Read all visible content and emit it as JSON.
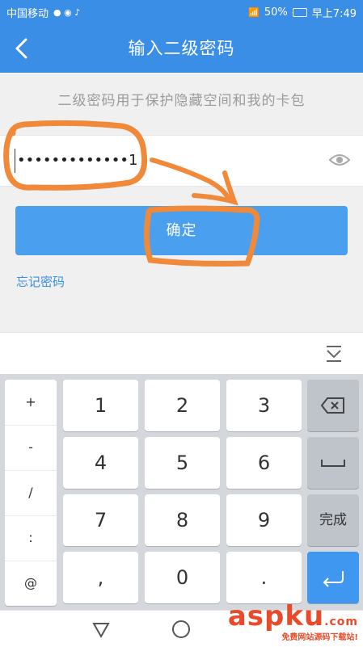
{
  "status": {
    "carrier": "中国移动",
    "battery": "50%",
    "time": "早上7:49"
  },
  "header": {
    "title": "输入二级密码"
  },
  "hint": "二级密码用于保护隐藏空间和我的卡包",
  "password": {
    "value": "•••••••••••••1"
  },
  "confirm_label": "确定",
  "forgot_label": "忘记密码",
  "keyboard": {
    "symbols": [
      "+",
      "-",
      "/",
      ":",
      "@"
    ],
    "rows": [
      [
        "1",
        "2",
        "3"
      ],
      [
        "4",
        "5",
        "6"
      ],
      [
        "7",
        "8",
        "9"
      ],
      [
        ",",
        "0",
        "."
      ]
    ],
    "done_label": "完成"
  },
  "watermark": {
    "brand": "aspku",
    "tld": ".com",
    "tagline": "免费网站源码下载站!"
  },
  "colors": {
    "accent": "#3a8ee6",
    "button": "#4aa0ef",
    "annotation": "#f0893a"
  }
}
